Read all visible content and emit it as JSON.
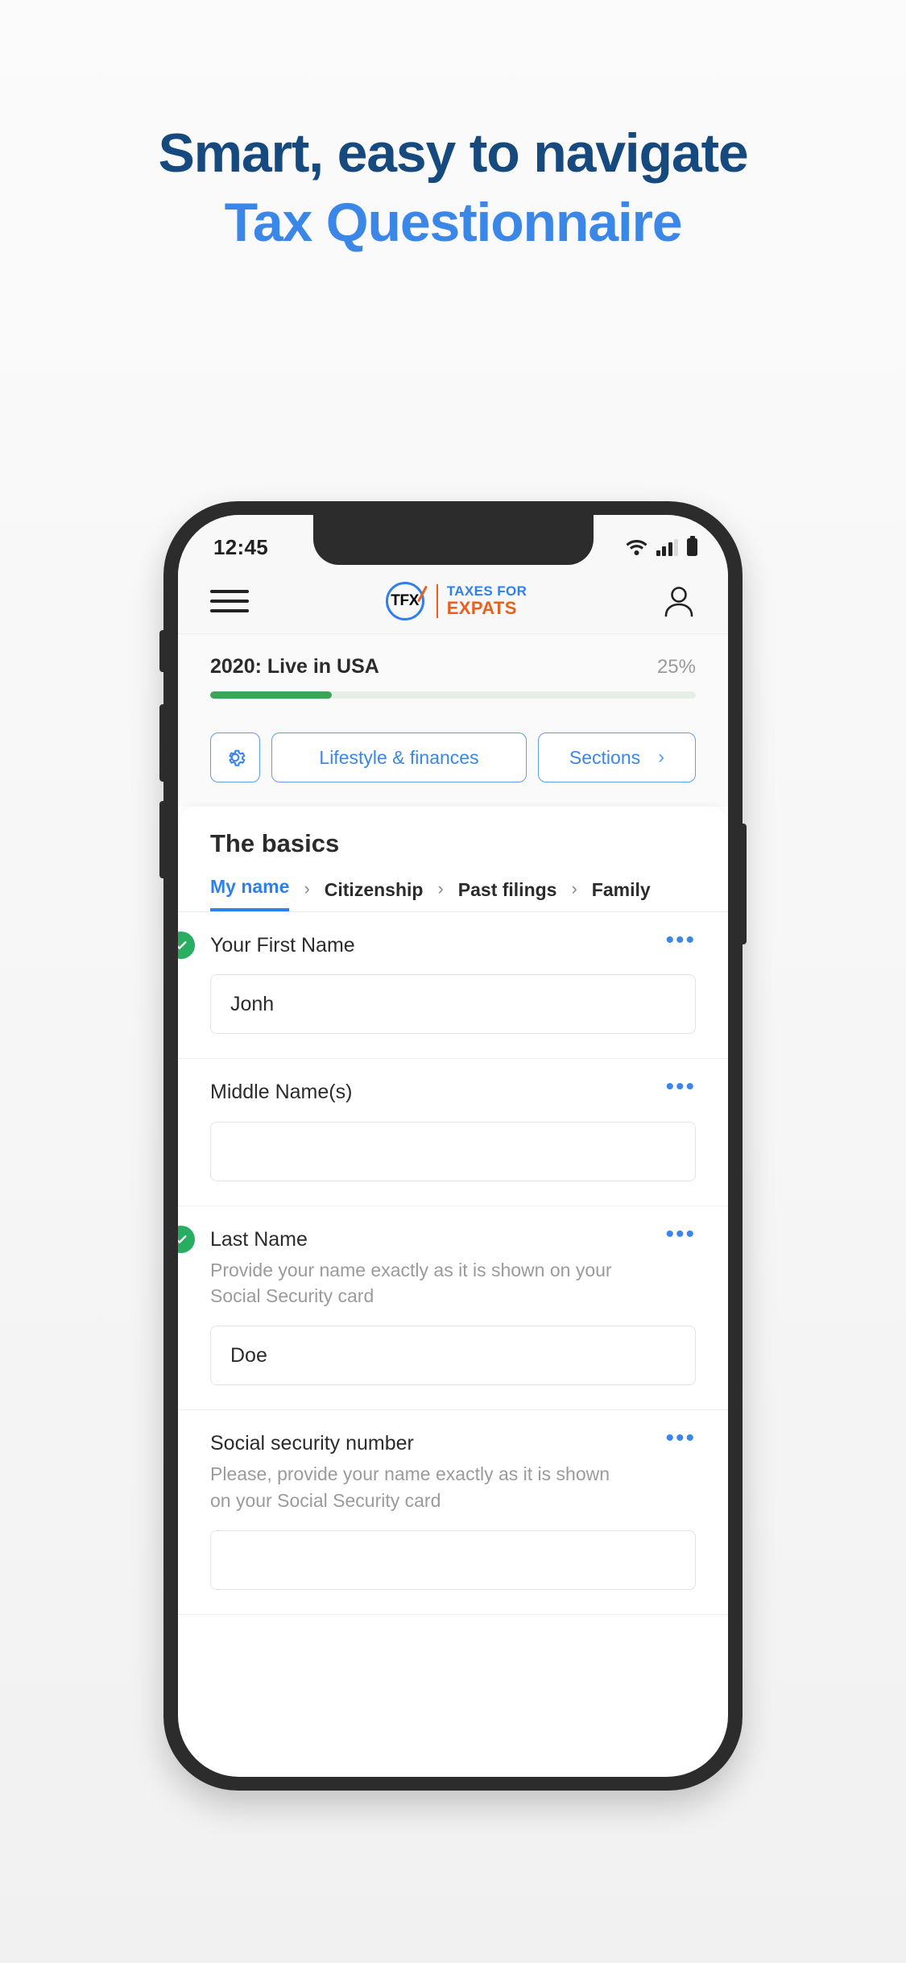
{
  "hero": {
    "line1": "Smart, easy to navigate",
    "line2": "Tax Questionnaire",
    "color_line1": "#164a7f",
    "color_line2": "#3b87e8"
  },
  "status_bar": {
    "time": "12:45",
    "wifi_icon": "wifi-icon",
    "signal_icon": "cellular-signal-icon",
    "battery_icon": "battery-icon"
  },
  "app_bar": {
    "menu_icon": "hamburger-menu-icon",
    "logo": {
      "mark_text": "TFX",
      "line1": "TAXES FOR",
      "line2": "EXPATS",
      "brand_blue": "#2f80ed",
      "brand_orange": "#e8601c"
    },
    "account_icon": "user-account-icon"
  },
  "progress": {
    "title": "2020: Live in USA",
    "percent_label": "25%",
    "percent_value": 25,
    "fill_color": "#3aa655",
    "track_color": "#e5efe7"
  },
  "toolbar": {
    "settings_icon": "gear-icon",
    "category_label": "Lifestyle & finances",
    "sections_label": "Sections",
    "sections_chevron": "›"
  },
  "section": {
    "title": "The basics",
    "tabs": [
      {
        "label": "My name",
        "active": true
      },
      {
        "label": "Citizenship",
        "active": false
      },
      {
        "label": "Past filings",
        "active": false
      },
      {
        "label": "Family",
        "active": false
      }
    ],
    "separator": "›"
  },
  "fields": [
    {
      "label": "Your First Name",
      "help": "",
      "value": "Jonh",
      "completed": true,
      "menu": "•••"
    },
    {
      "label": "Middle Name(s)",
      "help": "",
      "value": "",
      "completed": false,
      "menu": "•••"
    },
    {
      "label": "Last Name",
      "help": "Provide your name exactly as it is shown on your Social Security card",
      "value": "Doe",
      "completed": true,
      "menu": "•••"
    },
    {
      "label": "Social security number",
      "help": "Please, provide your name exactly as it is shown on your Social Security card",
      "value": "",
      "completed": false,
      "menu": "•••"
    }
  ]
}
